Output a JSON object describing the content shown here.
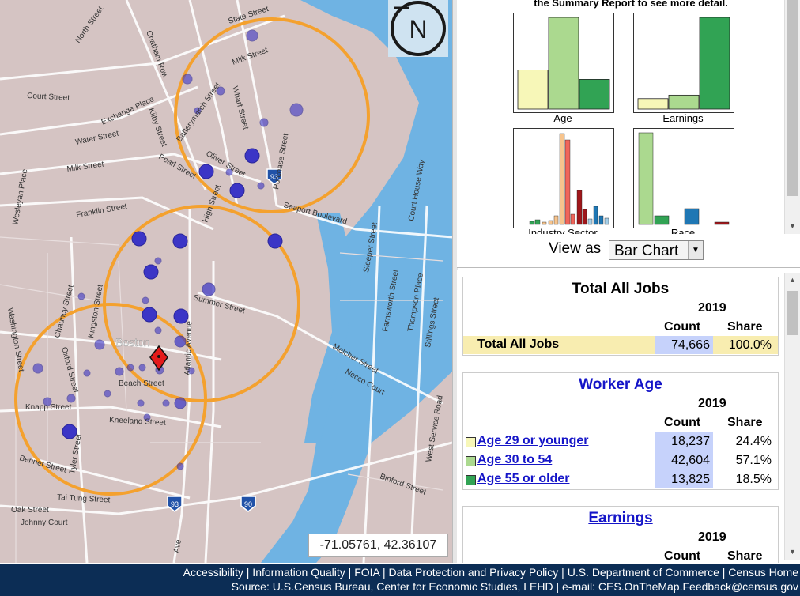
{
  "map": {
    "coordinates": "-71.05761, 42.36107",
    "compass_letter": "N",
    "place_label": "Boston",
    "streets": [
      "State Street",
      "Milk Street",
      "North Street",
      "Chatham Row",
      "Court Street",
      "Exchange Place",
      "Water Street",
      "Kilby Street",
      "Batterymarch Street",
      "Wharf Street",
      "Oliver Street",
      "Purchase Street",
      "Pearl Street",
      "Milk Street",
      "Franklin Street",
      "High Street",
      "Seaport Boulevard",
      "Court House Way",
      "Summer Street",
      "Congress Street",
      "Sleeper Street",
      "Farnsworth Street",
      "Thompson Place",
      "Stillings Street",
      "Chauncy Street",
      "Kingston Street",
      "Oxford Street",
      "Atlantic Avenue",
      "Beach Street",
      "Knapp Street",
      "Kneeland Street",
      "Bennet Street",
      "Tyler Street",
      "Tai Tung Street",
      "Oak Street",
      "Johnny Court",
      "Melcher Street",
      "Necco Court",
      "West Service Road",
      "Binford Street",
      "Wesleyan Place",
      "Washington Street",
      "Ave"
    ],
    "shields": [
      "93",
      "93",
      "90"
    ]
  },
  "charts_panel": {
    "note": "the Summary Report to see more detail.",
    "mini_charts": [
      {
        "label": "Age",
        "values": [
          24.4,
          57.1,
          18.5
        ],
        "colors": [
          "#f7f7b8",
          "#abd98f",
          "#31a354"
        ]
      },
      {
        "label": "Earnings",
        "values": [
          9,
          12,
          79
        ],
        "colors": [
          "#f7f7b8",
          "#abd98f",
          "#31a354"
        ]
      },
      {
        "label": "Industry Sector"
      },
      {
        "label": "Race"
      }
    ],
    "view_as_label": "View as",
    "view_as_value": "Bar Chart"
  },
  "report": {
    "total_jobs": {
      "title": "Total All Jobs",
      "year": "2019",
      "count_header": "Count",
      "share_header": "Share",
      "row": {
        "label": "Total All Jobs",
        "count": "74,666",
        "share": "100.0%"
      }
    },
    "worker_age": {
      "title": "Worker Age",
      "year": "2019",
      "count_header": "Count",
      "share_header": "Share",
      "rows": [
        {
          "label": "Age 29 or younger",
          "count": "18,237",
          "share": "24.4%",
          "color": "#f7f7b8"
        },
        {
          "label": "Age 30 to 54",
          "count": "42,604",
          "share": "57.1%",
          "color": "#abd98f"
        },
        {
          "label": "Age 55 or older",
          "count": "13,825",
          "share": "18.5%",
          "color": "#31a354"
        }
      ]
    },
    "earnings": {
      "title": "Earnings",
      "year": "2019",
      "count_header": "Count",
      "share_header": "Share"
    }
  },
  "footer": {
    "line1": "Accessibility | Information Quality | FOIA | Data Protection and Privacy Policy | U.S. Department of Commerce | Census Home",
    "line2": "Source: U.S.Census Bureau, Center for Economic Studies, LEHD | e-mail: CES.OnTheMap.Feedback@census.gov"
  }
}
